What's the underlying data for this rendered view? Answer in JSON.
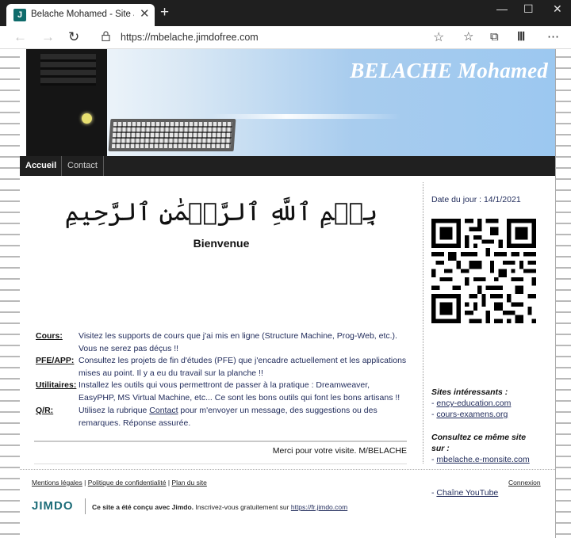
{
  "browser": {
    "tab_title": "Belache Mohamed - Site Jimdo d",
    "favicon_letter": "J",
    "url": "https://mbelache.jimdofree.com",
    "icons": [
      "back-icon",
      "forward-icon",
      "refresh-icon",
      "lock-icon",
      "star-icon",
      "favorites-icon",
      "collections-icon",
      "library-icon",
      "more-icon",
      "minimize-icon",
      "maximize-icon",
      "close-icon"
    ]
  },
  "site": {
    "banner_title": "BELACHE Mohamed",
    "nav": [
      "Accueil",
      "Contact"
    ],
    "main": {
      "bismillah": "بِسۡمِ ٱللَّهِ ٱلرَّحۡمَٰنِ ٱلرَّحِيمِ",
      "welcome": "Bienvenue",
      "sections": {
        "cours": {
          "label": "Cours:",
          "text": "Visitez les supports de cours que j'ai mis en ligne (Structure Machine, Prog-Web, etc.). Vous ne serez pas déçus !!"
        },
        "pfe": {
          "label": "PFE/APP:",
          "text": "Consultez les projets de fin d'études (PFE) que j'encadre actuellement et les applications mises au point. Il y a eu du travail sur la planche !!"
        },
        "util": {
          "label": "Utilitaires:",
          "text": "Installez les outils qui vous permettront de passer à la pratique : Dreamweaver, EasyPHP, MS Virtual Machine, etc... Ce sont les bons outils qui font les bons artisans !!"
        },
        "qr": {
          "label": "Q/R:",
          "text_before": "Utilisez la rubrique",
          "link": "Contact",
          "text_after": "pour m'envoyer un message, des suggestions ou des remarques. Réponse assurée."
        }
      },
      "thanks": "Merci pour votre visite. M/BELACHE"
    },
    "sidebar": {
      "date": "Date du jour : 14/1/2021",
      "sites_heading": "Sites intéressants :",
      "sites": [
        "ency-education.com",
        "cours-examens.org"
      ],
      "consult_heading_1": "Consultez ce même site",
      "consult_heading_2": "sur :",
      "consult_link": "mbelache.e-monsite.com",
      "youtube": "Chaîne YouTube",
      "bullet": "- "
    },
    "footer": {
      "links": [
        "Mentions légales",
        "Politique de confidentialité",
        "Plan du site"
      ],
      "separator": " | ",
      "login": "Connexion",
      "jimdo_logo": "JIMDO",
      "jimdo_text_bold": "Ce site a été conçu avec Jimdo.",
      "jimdo_text": " Inscrivez-vous gratuitement sur ",
      "jimdo_url": "https://fr.jimdo.com"
    }
  }
}
